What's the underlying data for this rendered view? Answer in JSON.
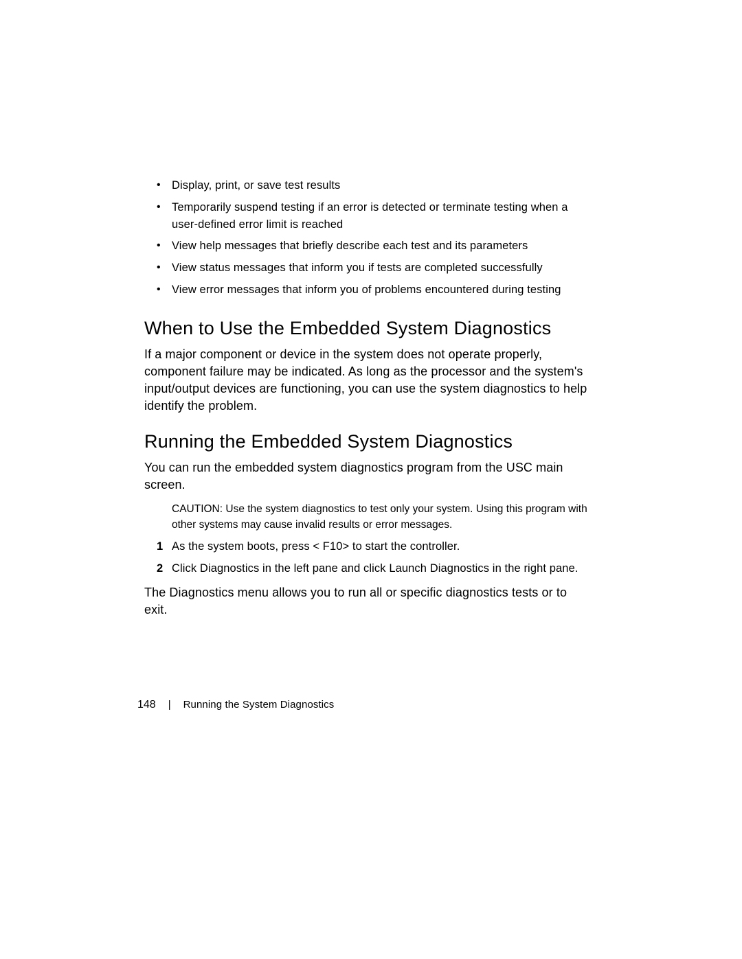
{
  "bullets": [
    "Display, print, or save test results",
    "Temporarily suspend testing if an error is detected or terminate testing when a user-defined error limit is reached",
    "View help messages that briefly describe each test and its parameters",
    "View status messages that inform you if tests are completed successfully",
    "View error messages that inform you of problems encountered during testing"
  ],
  "section1": {
    "heading": "When to Use the Embedded System Diagnostics",
    "para": "If a major component or device in the system does not operate properly, component failure may be indicated. As long as the processor and the system's input/output devices are functioning, you can use the system diagnostics to help identify the problem."
  },
  "section2": {
    "heading": "Running the Embedded System Diagnostics",
    "para1": "You can run the embedded system diagnostics program from the USC main screen.",
    "caution_label": "CAUTION:",
    "caution_text": " Use the system diagnostics to test only your system. Using this program with other systems may cause invalid results or error messages.",
    "steps": [
      "As the system boots, press < F10>  to start the controller.",
      "Click Diagnostics in the left pane and click Launch Diagnostics in the right pane."
    ],
    "para2": "The Diagnostics menu allows you to run all or specific diagnostics tests or to exit."
  },
  "footer": {
    "page_number": "148",
    "divider": "|",
    "text": "Running the System Diagnostics"
  }
}
